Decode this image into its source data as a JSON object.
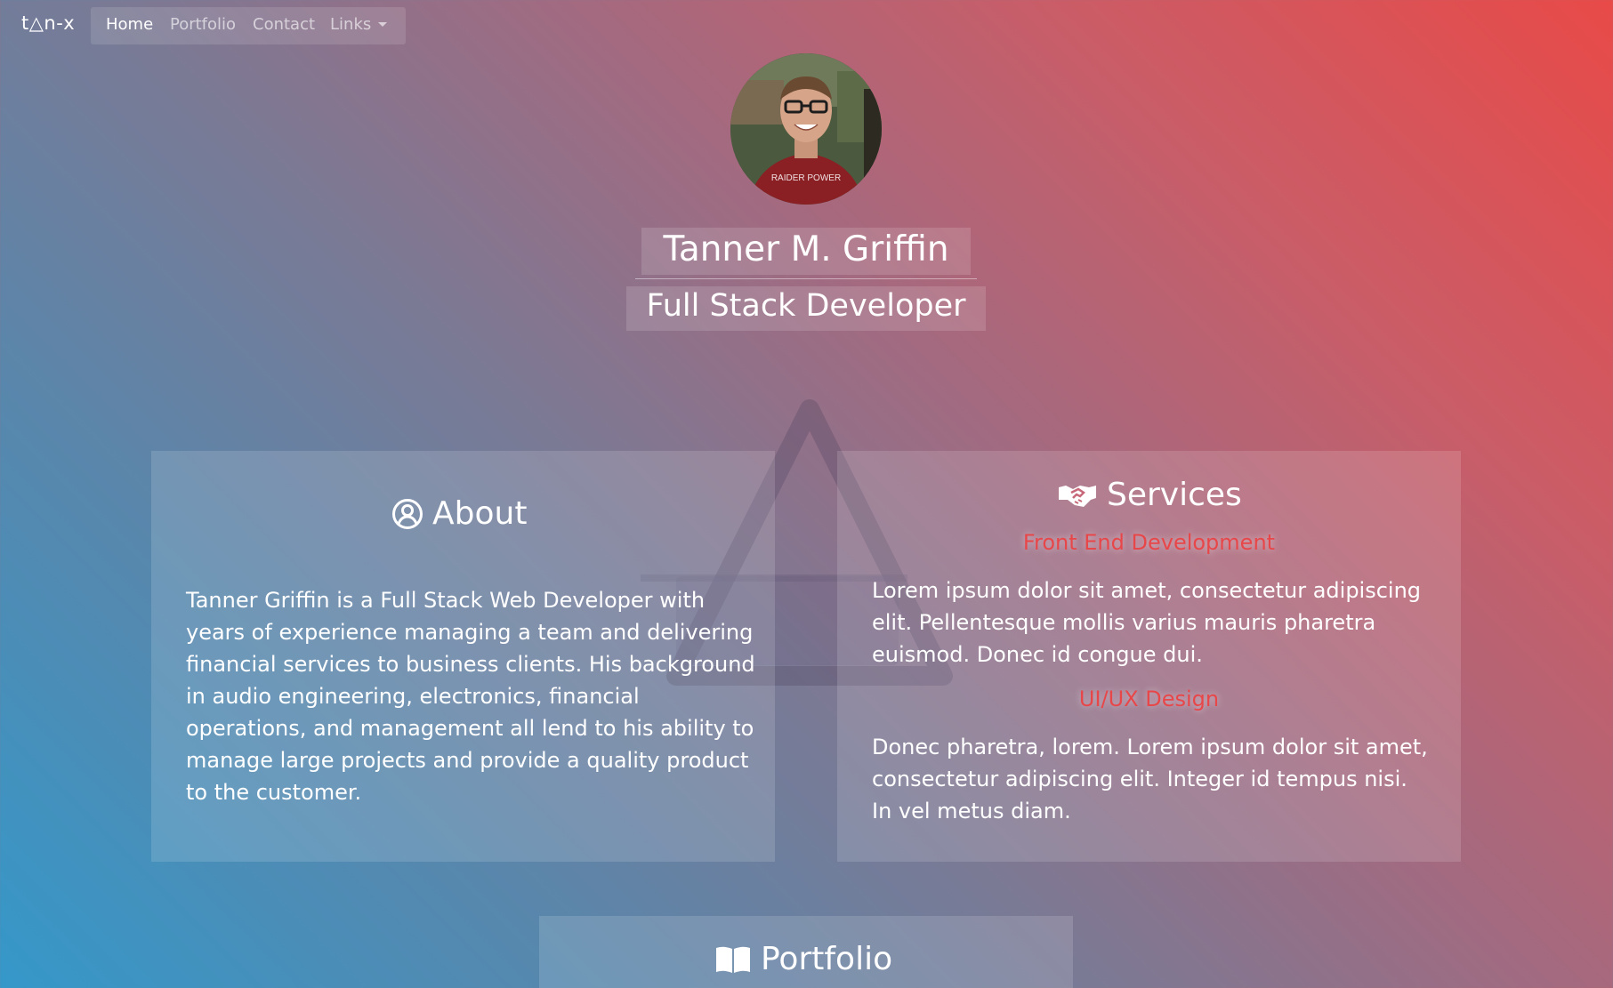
{
  "nav": {
    "brand": "t△n-x",
    "links": [
      {
        "label": "Home",
        "active": true
      },
      {
        "label": "Portfolio",
        "active": false
      },
      {
        "label": "Contact",
        "active": false
      },
      {
        "label": "Links",
        "active": false,
        "dropdown": true
      }
    ]
  },
  "hero": {
    "avatar_icon": "profile-photo",
    "shirt_text": "RAIDER POWER",
    "name": "Tanner M. Griffin",
    "title": "Full Stack Developer"
  },
  "about": {
    "icon": "user-circle-icon",
    "heading": "About",
    "text": "Tanner Griffin is a Full Stack Web Developer with years of experience managing a team and delivering financial services to business clients. His background in audio engineering, electronics, financial operations, and management all lend to his ability to manage large projects and provide a quality product to the customer."
  },
  "services": {
    "icon": "handshake-icon",
    "heading": "Services",
    "items": [
      {
        "title": "Front End Development",
        "text": "Lorem ipsum dolor sit amet, consectetur adipiscing elit. Pellentesque mollis varius mauris pharetra euismod. Donec id congue dui."
      },
      {
        "title": "UI/UX Design",
        "text": "Donec pharetra, lorem. Lorem ipsum dolor sit amet, consectetur adipiscing elit. Integer id tempus nisi. In vel metus diam."
      }
    ]
  },
  "portfolio": {
    "icon": "open-book-icon",
    "heading": "Portfolio"
  },
  "colors": {
    "gradient_red": "#e84a48",
    "gradient_blue": "#3598c9",
    "accent_red": "#e8474a",
    "accent_blue": "#3f8ecb"
  }
}
